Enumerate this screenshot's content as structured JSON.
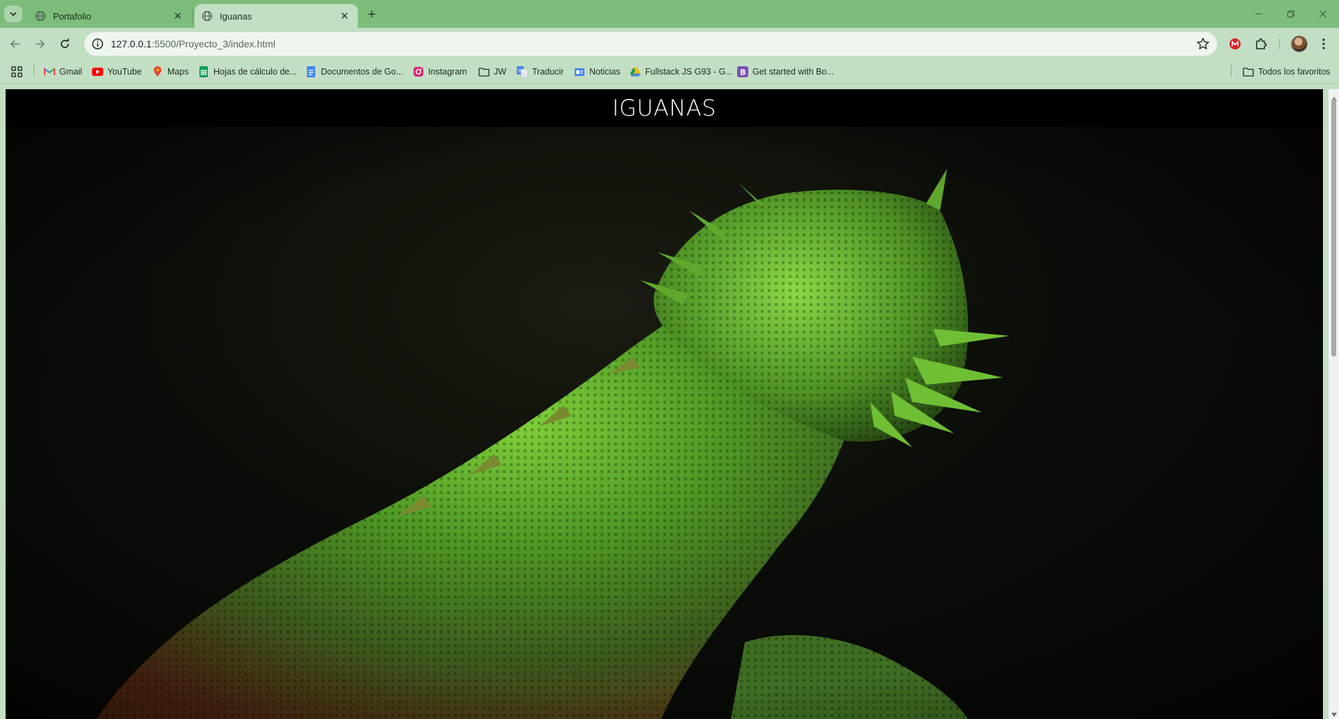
{
  "browser": {
    "tabs": [
      {
        "title": "Portafolio",
        "active": false
      },
      {
        "title": "Iguanas",
        "active": true
      }
    ],
    "url": {
      "host": "127.0.0.1",
      "path": ":5500/Proyecto_3/index.html"
    },
    "bookmarks": [
      {
        "label": "Gmail",
        "icon": "gmail-icon"
      },
      {
        "label": "YouTube",
        "icon": "youtube-icon"
      },
      {
        "label": "Maps",
        "icon": "maps-icon"
      },
      {
        "label": "Hojas de cálculo de...",
        "icon": "sheets-icon"
      },
      {
        "label": "Documentos de Go...",
        "icon": "docs-icon"
      },
      {
        "label": "Instagram",
        "icon": "instagram-icon"
      },
      {
        "label": "JW",
        "icon": "folder-icon"
      },
      {
        "label": "Traducir",
        "icon": "translate-icon"
      },
      {
        "label": "Noticias",
        "icon": "news-icon"
      },
      {
        "label": "Fullstack JS G93 - G...",
        "icon": "drive-icon"
      },
      {
        "label": "Get started with Bo...",
        "icon": "bootstrap-icon"
      }
    ],
    "all_bookmarks": "Todos los favoritos",
    "colors": {
      "frame": "#7dbd7b",
      "toolbar": "#c3dfc3"
    }
  },
  "page": {
    "title": "IGUANAS",
    "hero_image": "green-iguana-photo"
  }
}
